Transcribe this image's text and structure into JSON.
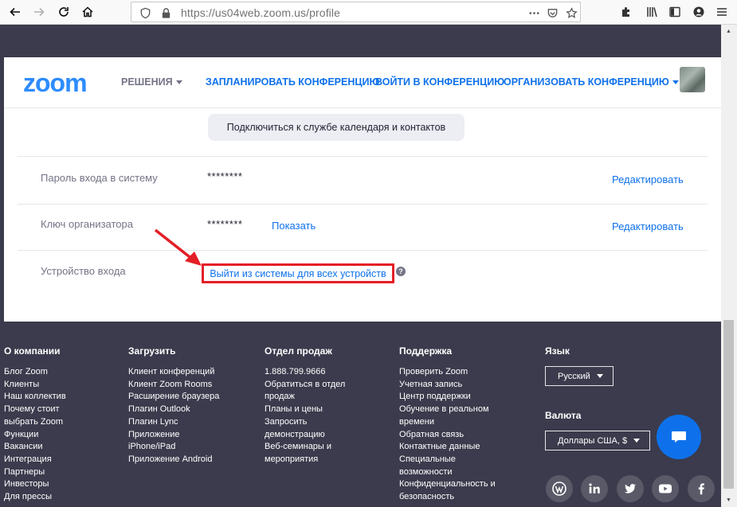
{
  "browser": {
    "url_host": "https://us04web.zoom.us",
    "url_path": "/profile"
  },
  "header": {
    "logo": "zoom",
    "solutions": "РЕШЕНИЯ",
    "schedule": "ЗАПЛАНИРОВАТЬ КОНФЕРЕНЦИЮ",
    "join": "ВОЙТИ В КОНФЕРЕНЦИЮ",
    "host": "ОРГАНИЗОВАТЬ КОНФЕРЕНЦИЮ"
  },
  "profile": {
    "calendar_button": "Подключиться к службе календаря и контактов",
    "password_label": "Пароль входа в систему",
    "password_value": "********",
    "password_edit": "Редактировать",
    "hostkey_label": "Ключ организатора",
    "hostkey_value": "********",
    "hostkey_show": "Показать",
    "hostkey_edit": "Редактировать",
    "device_label": "Устройство входа",
    "signout_all": "Выйти из системы для всех устройств",
    "help_glyph": "?"
  },
  "footer": {
    "company": {
      "title": "О компании",
      "items": [
        "Блог Zoom",
        "Клиенты",
        "Наш коллектив",
        "Почему стоит",
        "выбрать Zoom",
        "Функции",
        "Вакансии",
        "Интеграция",
        "Партнеры",
        "Инвесторы",
        "Для прессы"
      ]
    },
    "download": {
      "title": "Загрузить",
      "items": [
        "Клиент конференций",
        "Клиент Zoom Rooms",
        "Расширение браузера",
        "Плагин Outlook",
        "Плагин Lync",
        "Приложение",
        "iPhone/iPad",
        "Приложение Android"
      ]
    },
    "sales": {
      "title": "Отдел продаж",
      "items": [
        "1.888.799.9666",
        "Обратиться в отдел",
        "продаж",
        "Планы и цены",
        "Запросить",
        "демонстрацию",
        "Веб-семинары и",
        "мероприятия"
      ]
    },
    "support": {
      "title": "Поддержка",
      "items": [
        "Проверить Zoom",
        "Учетная запись",
        "Центр поддержки",
        "Обучение в реальном",
        "времени",
        "Обратная связь",
        "Контактные данные",
        "Специальные",
        "возможности",
        "Конфиденциальность и",
        "безопасность"
      ]
    },
    "language_title": "Язык",
    "language_value": "Русский",
    "currency_title": "Валюта",
    "currency_value": "Доллары США, $",
    "social": [
      "wordpress-icon",
      "linkedin-icon",
      "twitter-icon",
      "youtube-icon",
      "facebook-icon"
    ]
  },
  "colors": {
    "zoom_blue": "#2d8cff",
    "link_blue": "#0e71eb",
    "dark_band": "#3b3b4d",
    "highlight_red": "#e41e26"
  }
}
